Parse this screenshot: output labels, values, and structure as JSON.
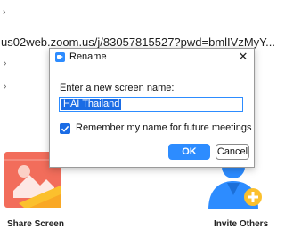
{
  "background": {
    "chevron": "›",
    "url": "us02web.zoom.us/j/83057815527?pwd=bmlIVzMyY...",
    "dot_1": "›",
    "dot_2": "›"
  },
  "dialog": {
    "title": "Rename",
    "close_glyph": "✕",
    "prompt": "Enter a new screen name:",
    "name_value": "HAI Thailand",
    "remember_label": "Remember my name for future meetings",
    "remember_checked": true,
    "ok_label": "OK",
    "cancel_label": "Cancel",
    "accent_color": "#2d8cff"
  },
  "tiles": [
    {
      "label": "Share Screen",
      "icon": "share-screen-icon",
      "color": "#f26d5b"
    },
    {
      "label": "Invite Others",
      "icon": "invite-others-icon",
      "color": "#2d8cff"
    }
  ]
}
